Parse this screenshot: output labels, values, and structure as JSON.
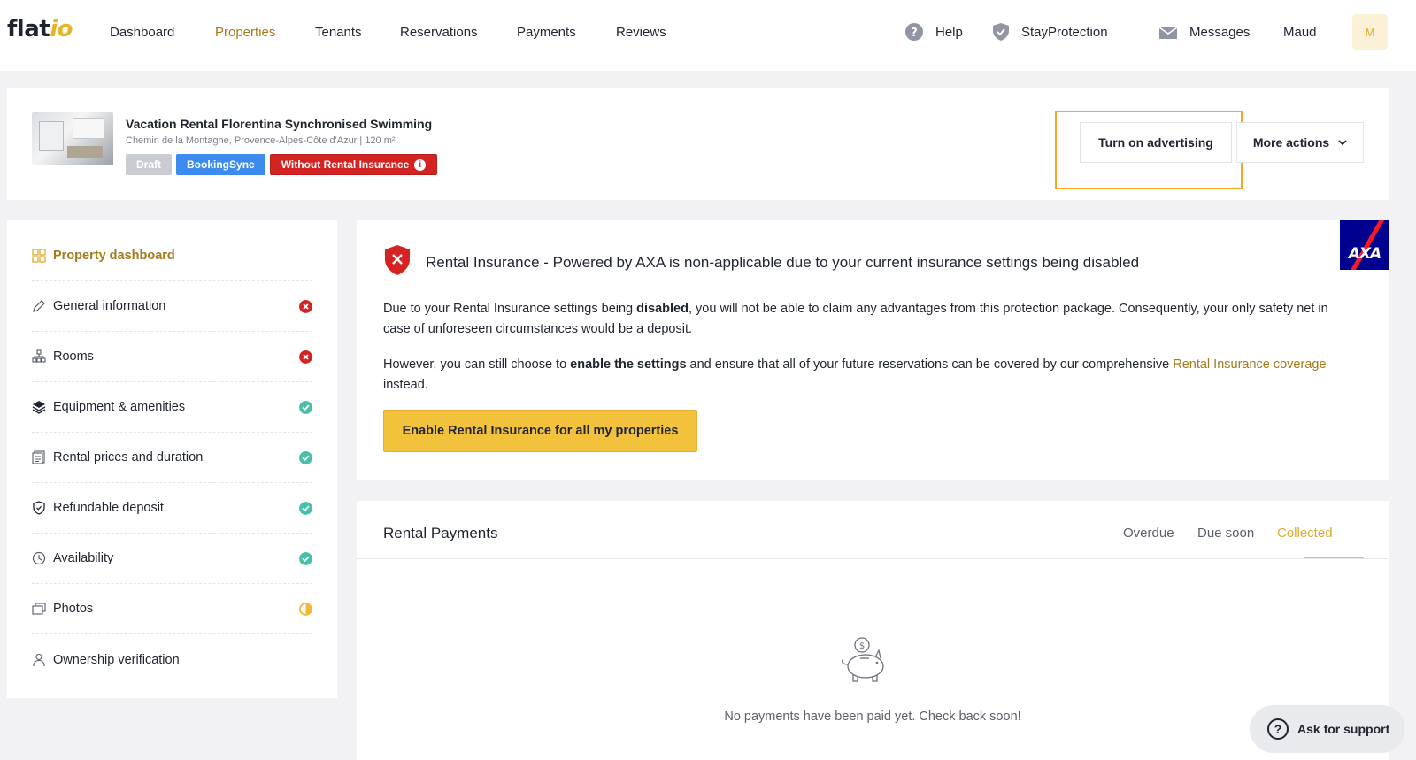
{
  "brand": {
    "logo_flat": "flat",
    "logo_io": "io"
  },
  "nav": {
    "items": [
      {
        "label": "Dashboard",
        "active": false
      },
      {
        "label": "Properties",
        "active": true
      },
      {
        "label": "Tenants",
        "active": false
      },
      {
        "label": "Reservations",
        "active": false
      },
      {
        "label": "Payments",
        "active": false
      },
      {
        "label": "Reviews",
        "active": false
      }
    ],
    "help_label": "Help",
    "stayprotection_label": "StayProtection",
    "messages_label": "Messages",
    "user_name": "Maud",
    "avatar_initial": "M"
  },
  "property": {
    "title": "Vacation Rental Florentina Synchronised Swimming",
    "address": "Chemin de la Montagne, Provence-Alpes-Côte d'Azur | 120 m²",
    "badges": {
      "draft": "Draft",
      "sync": "BookingSync",
      "no_insurance": "Without Rental Insurance",
      "info_glyph": "i"
    },
    "actions": {
      "advertise": "Turn on advertising",
      "more": "More actions"
    }
  },
  "sidebar": {
    "items": [
      {
        "label": "Property dashboard",
        "icon": "grid-icon",
        "status": "none"
      },
      {
        "label": "General information",
        "icon": "pencil-icon",
        "status": "error"
      },
      {
        "label": "Rooms",
        "icon": "rooms-icon",
        "status": "error"
      },
      {
        "label": "Equipment & amenities",
        "icon": "layers-icon",
        "status": "ok"
      },
      {
        "label": "Rental prices and duration",
        "icon": "prices-icon",
        "status": "ok"
      },
      {
        "label": "Refundable deposit",
        "icon": "shield-check-icon",
        "status": "ok"
      },
      {
        "label": "Availability",
        "icon": "clock-icon",
        "status": "ok"
      },
      {
        "label": "Photos",
        "icon": "photos-icon",
        "status": "partial"
      },
      {
        "label": "Ownership verification",
        "icon": "person-icon",
        "status": "none"
      }
    ]
  },
  "insurance": {
    "title": "Rental Insurance - Powered by AXA is non-applicable due to your current insurance settings being disabled",
    "axa_logo": "AXA",
    "p1_a": "Due to your Rental Insurance settings being ",
    "p1_b": "disabled",
    "p1_c": ", you will not be able to claim any advantages from this protection package. Consequently, your only safety net in case of unforeseen circumstances would be a deposit.",
    "p2_a": "However, you can still choose to ",
    "p2_b": "enable the settings",
    "p2_c": " and ensure that all of your future reservations can be covered by our comprehensive ",
    "p2_link": "Rental Insurance coverage",
    "p2_d": " instead.",
    "button": "Enable Rental Insurance for all my properties"
  },
  "payments": {
    "title": "Rental Payments",
    "tabs": [
      "Overdue",
      "Due soon",
      "Collected"
    ],
    "active_tab": "Collected",
    "empty": "No payments have been paid yet. Check back soon!"
  },
  "support": {
    "label": "Ask for support"
  },
  "colors": {
    "accent": "#f2c23d",
    "active_text": "#a57a1a",
    "error": "#d42323",
    "ok": "#46c1a8",
    "sync": "#3e8bf0"
  }
}
